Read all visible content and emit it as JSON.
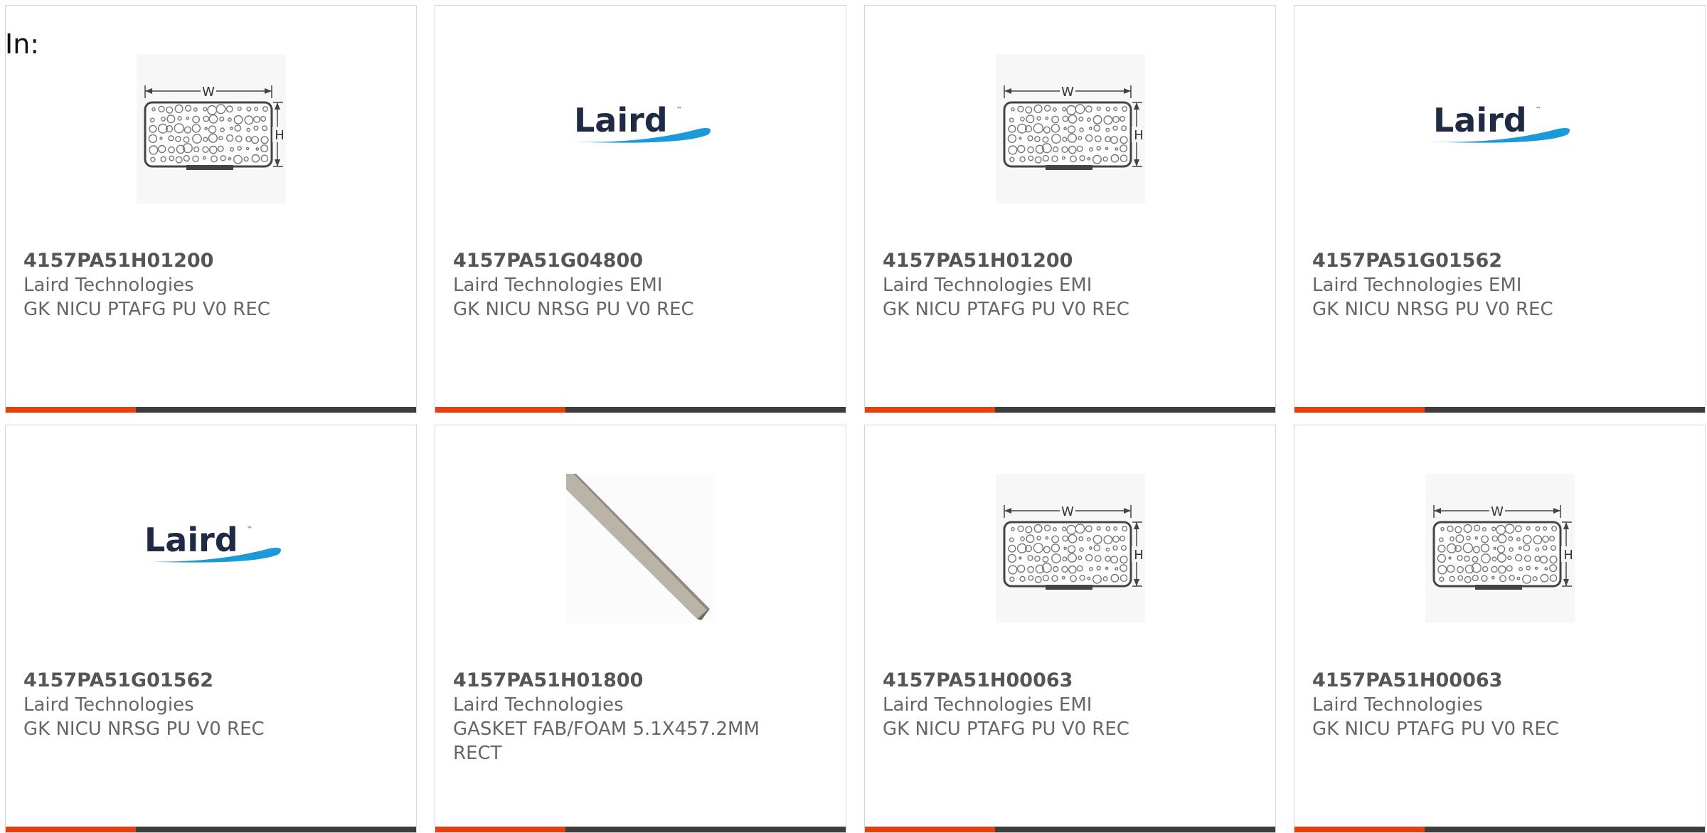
{
  "heading": "In:",
  "colors": {
    "accent": "#e8400c",
    "bar": "#3d3d3d",
    "text": "#666666",
    "border": "#d6d6d6",
    "logo_blue": "#1a9ad7"
  },
  "cards": [
    {
      "part_number": "4157PA51H01200",
      "manufacturer": "Laird Technologies",
      "description": "GK NICU PTAFG PU V0 REC",
      "image": "gasket-diagram"
    },
    {
      "part_number": "4157PA51G04800",
      "manufacturer": "Laird Technologies EMI",
      "description": "GK NICU NRSG PU V0 REC",
      "image": "laird-logo"
    },
    {
      "part_number": "4157PA51H01200",
      "manufacturer": "Laird Technologies EMI",
      "description": "GK NICU PTAFG PU V0 REC",
      "image": "gasket-diagram"
    },
    {
      "part_number": "4157PA51G01562",
      "manufacturer": "Laird Technologies EMI",
      "description": "GK NICU NRSG PU V0 REC",
      "image": "laird-logo"
    },
    {
      "part_number": "4157PA51G01562",
      "manufacturer": "Laird Technologies",
      "description": "GK NICU NRSG PU V0 REC",
      "image": "laird-logo"
    },
    {
      "part_number": "4157PA51H01800",
      "manufacturer": "Laird Technologies",
      "description": "GASKET FAB/FOAM 5.1X457.2MM RECT",
      "image": "foam-strip"
    },
    {
      "part_number": "4157PA51H00063",
      "manufacturer": "Laird Technologies EMI",
      "description": "GK NICU PTAFG PU V0 REC",
      "image": "gasket-diagram"
    },
    {
      "part_number": "4157PA51H00063",
      "manufacturer": "Laird Technologies",
      "description": "GK NICU PTAFG PU V0 REC",
      "image": "gasket-diagram"
    }
  ],
  "diagram_labels": {
    "width": "W",
    "height": "H"
  },
  "logo_text": "Laird"
}
